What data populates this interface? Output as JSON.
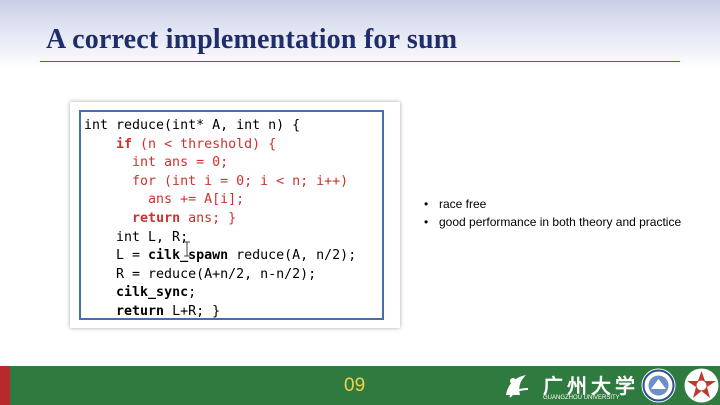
{
  "slide": {
    "title": "A correct implementation for sum",
    "page_number": "09"
  },
  "code": {
    "lines": [
      [
        {
          "t": "int reduce(int* A, int n) {"
        }
      ],
      [
        {
          "t": "    "
        },
        {
          "t": "if",
          "c": "r b"
        },
        {
          "t": " (n < threshold) {",
          "c": "r"
        }
      ],
      [
        {
          "t": "      int ans = 0;",
          "c": "r"
        }
      ],
      [
        {
          "t": "      for (int i = 0; i < n; i++)",
          "c": "r"
        }
      ],
      [
        {
          "t": "        ans += A[i];",
          "c": "r"
        }
      ],
      [
        {
          "t": "      "
        },
        {
          "t": "return",
          "c": "r b"
        },
        {
          "t": " ans; }",
          "c": "r"
        }
      ],
      [
        {
          "t": "    int L, R;"
        }
      ],
      [
        {
          "t": "    L = "
        },
        {
          "t": "cilk_spawn",
          "c": "b"
        },
        {
          "t": " reduce(A, n/2);"
        }
      ],
      [
        {
          "t": "    R = reduce(A+n/2, n-n/2);"
        }
      ],
      [
        {
          "t": "    "
        },
        {
          "t": "cilk_sync",
          "c": "b"
        },
        {
          "t": ";"
        }
      ],
      [
        {
          "t": "    "
        },
        {
          "t": "return",
          "c": "b"
        },
        {
          "t": " L+R; }"
        }
      ]
    ]
  },
  "bullets": [
    "race free",
    "good performance in both theory and practice"
  ],
  "footer": {
    "logo_name": "广州大学",
    "logo_subtitle": "GUANGZHOU UNIVERSITY",
    "emblem_icon": "university-emblem-icon",
    "seal_icon": "university-seal-icon",
    "badge_icon": "badge-icon"
  },
  "colors": {
    "title": "#1f2d6b",
    "code_keyword_red": "#d0312d",
    "footer_green": "#2f7a3e",
    "page_number": "#f2d14a",
    "accent_red": "#b8292c"
  }
}
